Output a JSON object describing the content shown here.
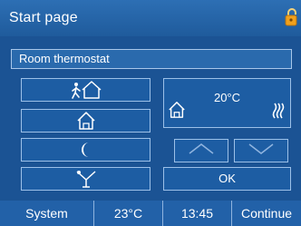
{
  "header": {
    "title": "Start page",
    "badge_icon": "lock-icon"
  },
  "subheader": {
    "title": "Room thermostat"
  },
  "modes": [
    {
      "name": "away",
      "icon": "person-leaving-house-icon"
    },
    {
      "name": "home",
      "icon": "house-icon"
    },
    {
      "name": "night",
      "icon": "moon-icon"
    },
    {
      "name": "party",
      "icon": "cocktail-glass-icon"
    }
  ],
  "display": {
    "temperature": "20°C",
    "mode_icon": "house-icon",
    "heat_icon": "heating-icon"
  },
  "controls": {
    "up_icon": "chevron-up-icon",
    "down_icon": "chevron-down-icon",
    "ok_label": "OK"
  },
  "statusbar": {
    "system_label": "System",
    "outdoor_temp": "23°C",
    "time": "13:45",
    "continue_label": "Continue"
  },
  "colors": {
    "background": "#1b5394",
    "button": "#1d5da3",
    "border": "#9cc0e8",
    "badge": "#f2a11c"
  }
}
